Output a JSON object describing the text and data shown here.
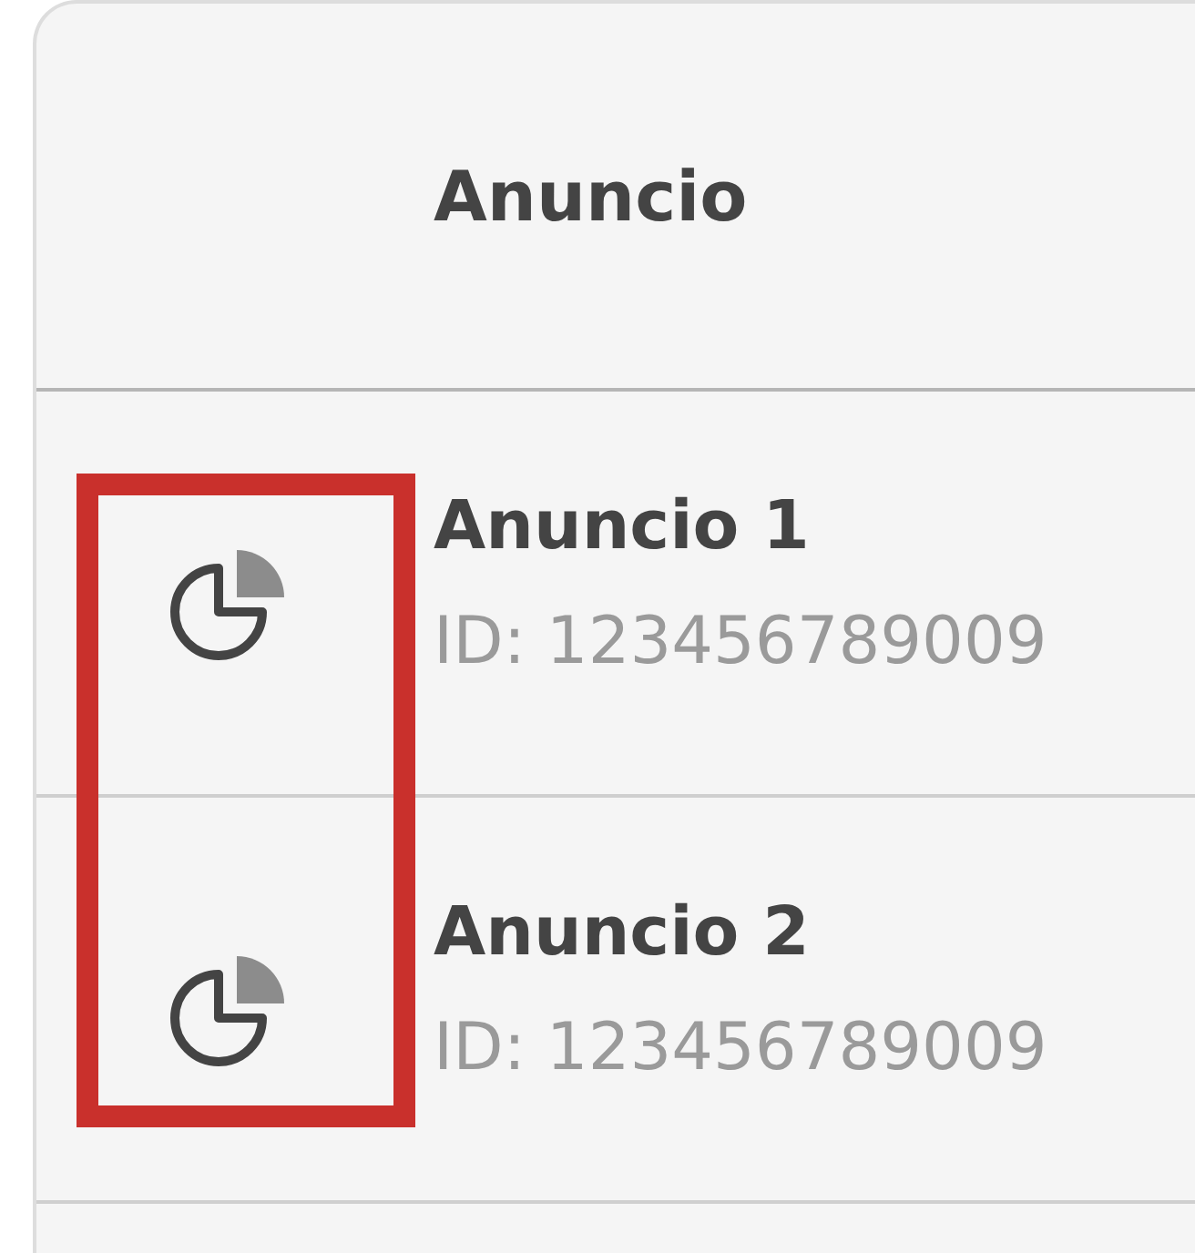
{
  "table": {
    "header": "Anuncio",
    "icon_column_highlighted": true,
    "rows": [
      {
        "title": "Anuncio 1",
        "id": "ID: 123456789009"
      },
      {
        "title": "Anuncio 2",
        "id": "ID: 123456789009"
      }
    ]
  }
}
